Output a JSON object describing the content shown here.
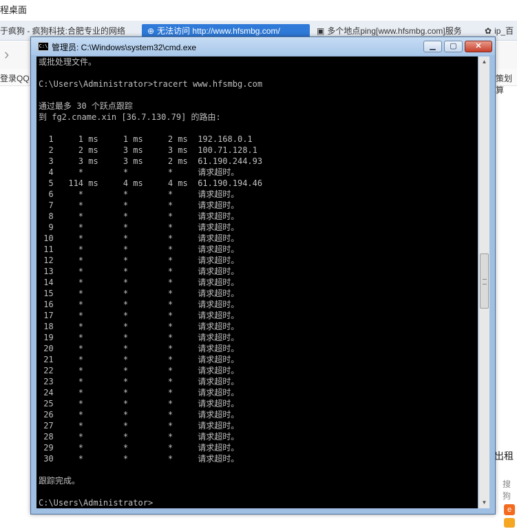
{
  "browser": {
    "window_title": "程桌面",
    "tabs": [
      {
        "label": "于疯狗 - 疯狗科技:合肥专业的网络"
      },
      {
        "label": "无法访问 http://www.hfsmbg.com/"
      },
      {
        "label": "多个地点ping[www.hfsmbg.com]服务"
      },
      {
        "label": "ip_百"
      }
    ],
    "bookmark_left": "登录QQ",
    "bookmark_right": "策划算",
    "side_text_1": "出租",
    "side_text_2": "搜狗"
  },
  "cmd": {
    "title": "管理员: C:\\Windows\\system32\\cmd.exe",
    "buttons": {
      "minimize": "▁",
      "maximize": "▢",
      "close": "✕"
    },
    "lines": [
      "或批处理文件。",
      "",
      "C:\\Users\\Administrator>tracert www.hfsmbg.com",
      "",
      "通过最多 30 个跃点跟踪",
      "到 fg2.cname.xin [36.7.130.79] 的路由:",
      "",
      "  1     1 ms     1 ms     2 ms  192.168.0.1",
      "  2     2 ms     3 ms     3 ms  100.71.128.1",
      "  3     3 ms     3 ms     2 ms  61.190.244.93",
      "  4     *        *        *     请求超时。",
      "  5   114 ms     4 ms     4 ms  61.190.194.46",
      "  6     *        *        *     请求超时。",
      "  7     *        *        *     请求超时。",
      "  8     *        *        *     请求超时。",
      "  9     *        *        *     请求超时。",
      " 10     *        *        *     请求超时。",
      " 11     *        *        *     请求超时。",
      " 12     *        *        *     请求超时。",
      " 13     *        *        *     请求超时。",
      " 14     *        *        *     请求超时。",
      " 15     *        *        *     请求超时。",
      " 16     *        *        *     请求超时。",
      " 17     *        *        *     请求超时。",
      " 18     *        *        *     请求超时。",
      " 19     *        *        *     请求超时。",
      " 20     *        *        *     请求超时。",
      " 21     *        *        *     请求超时。",
      " 22     *        *        *     请求超时。",
      " 23     *        *        *     请求超时。",
      " 24     *        *        *     请求超时。",
      " 25     *        *        *     请求超时。",
      " 26     *        *        *     请求超时。",
      " 27     *        *        *     请求超时。",
      " 28     *        *        *     请求超时。",
      " 29     *        *        *     请求超时。",
      " 30     *        *        *     请求超时。",
      "",
      "跟踪完成。",
      "",
      "C:\\Users\\Administrator>"
    ]
  }
}
